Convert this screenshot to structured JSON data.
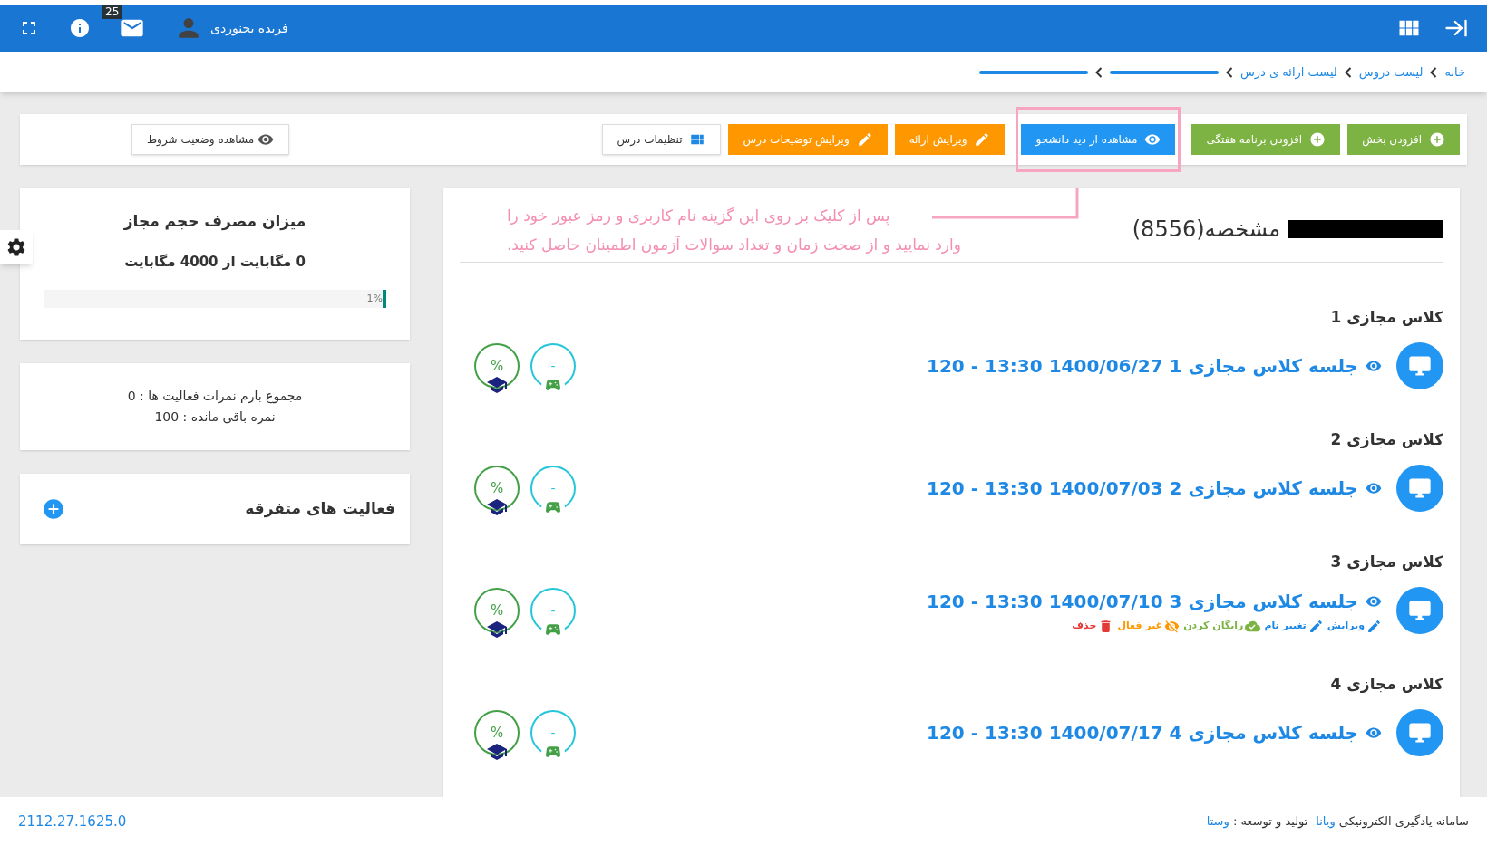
{
  "top_bar": {
    "user_name": "فریده بجنوردی",
    "mail_badge": "25"
  },
  "breadcrumb": [
    {
      "kind": "link",
      "label": "خانه"
    },
    {
      "kind": "link",
      "label": "لیست دروس"
    },
    {
      "kind": "link",
      "label": "لیست ارائه ی درس"
    },
    {
      "kind": "redacted"
    },
    {
      "kind": "redacted"
    }
  ],
  "toolbar": [
    {
      "kind": "success",
      "label": "افزودن بخش",
      "highlighted": false
    },
    {
      "kind": "success",
      "label": "افزودن برنامه هفتگی",
      "highlighted": false
    },
    {
      "kind": "primary",
      "label": "مشاهده از دید دانشجو",
      "highlighted": true
    },
    {
      "kind": "warning",
      "label": "ویرایش ارائه",
      "highlighted": false
    },
    {
      "kind": "warning",
      "label": "ویرایش توضیحات درس",
      "highlighted": false
    },
    {
      "kind": "default",
      "label": "تنظیمات درس",
      "highlighted": false
    }
  ],
  "conditions_button": {
    "label": "مشاهده وضعیت شروط"
  },
  "usage_card": {
    "title": "میزان مصرف حجم مجاز",
    "summary": "0 مگابایت از 4000 مگابایت",
    "level": 0.01,
    "reading": "1%"
  },
  "score_card": {
    "lines": [
      "مجموع بارم نمرات فعالیت ها : 0",
      "نمره باقی مانده : 100"
    ]
  },
  "misc_card": {
    "title": "فعالیت های متفرقه"
  },
  "course": {
    "title": "مشخصه(8556)",
    "redacted": true
  },
  "annotation": {
    "lines": [
      "پس از کلیک بر روی این گزینه  نام کاربری و رمز عبور خود را",
      "وارد نمایید و از صحت  زمان و تعداد سوالات آزمون  اطمینان حاصل کنید."
    ]
  },
  "sections": [
    {
      "title": "کلاس مجازی 1",
      "session": "جلسه کلاس مجازی 1 1400/06/27 13:30 - 120",
      "game": "-",
      "score": "%"
    },
    {
      "title": "کلاس مجازی 2",
      "session": "جلسه کلاس مجازی 2 1400/07/03 13:30 - 120",
      "game": "-",
      "score": "%"
    },
    {
      "title": "کلاس مجازی 3",
      "session": "جلسه کلاس مجازی 3 1400/07/10 13:30 - 120",
      "game": "-",
      "score": "%",
      "actions": [
        {
          "kind": "edit",
          "label": "ویرایش"
        },
        {
          "kind": "rename",
          "label": "تغییر نام"
        },
        {
          "kind": "free",
          "label": "رایگان کردن"
        },
        {
          "kind": "disable",
          "label": "غیر فعال"
        },
        {
          "kind": "delete",
          "label": "حذف"
        }
      ]
    },
    {
      "title": "کلاس مجازی 4",
      "session": "جلسه کلاس مجازی 4 1400/07/17 13:30 - 120",
      "game": "-",
      "score": "%"
    }
  ],
  "footer": {
    "text_before": "سامانه یادگیری الکترونیکی",
    "brand": "ویانا",
    "text_middle": "-تولید و توسعه :",
    "developer": "وستا",
    "version": "2112.27.1625.0"
  }
}
